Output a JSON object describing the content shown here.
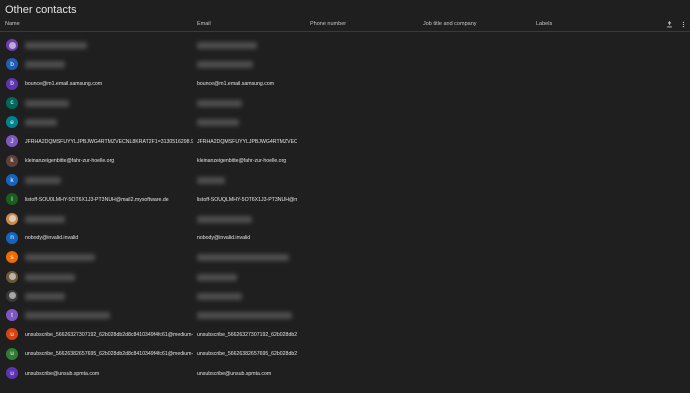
{
  "page": {
    "title": "Other contacts"
  },
  "columns": {
    "name": "Name",
    "email": "Email",
    "phone": "Phone number",
    "job": "Job title and company",
    "labels": "Labels"
  },
  "header_icons": [
    "export-icon",
    "more-vert-icon"
  ],
  "contacts": [
    {
      "avatar": "",
      "avatar_color": "#6d3fa8",
      "name": "",
      "email": "",
      "redacted": true
    },
    {
      "avatar": "b",
      "avatar_color": "#1e5fb4",
      "name": "",
      "email": "",
      "redacted": true
    },
    {
      "avatar": "b",
      "avatar_color": "#5e35b1",
      "name": "bounce@m1.email.samsung.com",
      "email": "bounce@m1.email.samsung.com",
      "redacted": false
    },
    {
      "avatar": "c",
      "avatar_color": "#00695c",
      "name": "",
      "email": "",
      "redacted": true
    },
    {
      "avatar": "e",
      "avatar_color": "#00838f",
      "name": "",
      "email": "",
      "redacted": true
    },
    {
      "avatar": "J",
      "avatar_color": "#7e57c2",
      "name": "JFRHA2DQMSFUYYLJPBJWG4RTMZVECNL8KRAT2F1=3130516298.9@unsub",
      "email": "JFRHA2DQMSFUYYLJPBJWG4RTMZVECNL...",
      "redacted": false
    },
    {
      "avatar": "k",
      "avatar_color": "#5d4037",
      "name": "kleinanzeigenbitte@fahr-zur-hoelle.org",
      "email": "kleinanzeigenbitte@fahr-zur-hoelle.org",
      "redacted": false
    },
    {
      "avatar": "k",
      "avatar_color": "#1565c0",
      "name": "",
      "email": "",
      "redacted": true
    },
    {
      "avatar": "l",
      "avatar_color": "#1b5e20",
      "name": "listoff-SOU0LMHY-5OT6X1J3-PT3NUH@mail2.mysoftware.de",
      "email": "listoff-SOUQLMHY-5OT6X1J3-PT3NUH@mai...",
      "redacted": false
    },
    {
      "avatar": "",
      "avatar_color": "#c58a52",
      "name": "",
      "email": "",
      "redacted": true
    },
    {
      "avatar": "n",
      "avatar_color": "#1565c0",
      "name": "nobody@invalid.invalid",
      "email": "nobody@invalid.invalid",
      "redacted": false
    },
    {
      "avatar": "s",
      "avatar_color": "#ef6c00",
      "name": "",
      "email": "",
      "redacted": true
    },
    {
      "avatar": "",
      "avatar_color": "#6b5a3a",
      "name": "",
      "email": "",
      "redacted": true
    },
    {
      "avatar": "",
      "avatar_color": "#3a3a3a",
      "name": "",
      "email": "",
      "redacted": true
    },
    {
      "avatar": "t",
      "avatar_color": "#7e57c2",
      "name": "",
      "email": "",
      "redacted": true
    },
    {
      "avatar": "u",
      "avatar_color": "#d84315",
      "name": "unsubscribe_56626327307192_62b028db2d8c8410349f4fc61@medium-a7e3t",
      "email": "unsubscribe_56626327307192_62b028db2d...",
      "redacted": false
    },
    {
      "avatar": "u",
      "avatar_color": "#2e7d32",
      "name": "unsubscribe_56626382657695_62b028db2d8c8410349f4fc61@medium-a7e3t",
      "email": "unsubscribe_56626382657695_62b028db2d...",
      "redacted": false
    },
    {
      "avatar": "u",
      "avatar_color": "#5e35b1",
      "name": "unsubscribe@unsub.spmta.com",
      "email": "unsubscribe@unsub.spmta.com",
      "redacted": false
    }
  ]
}
